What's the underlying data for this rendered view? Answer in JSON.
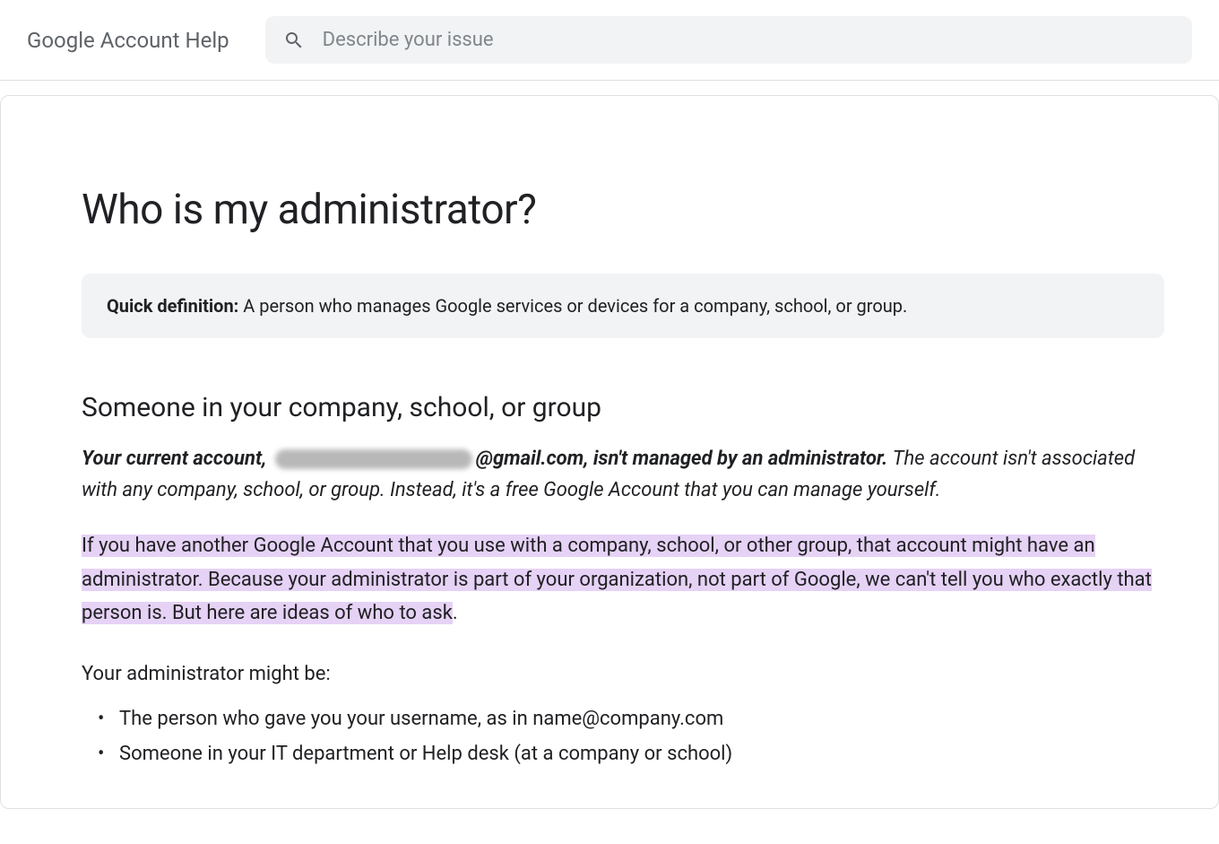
{
  "header": {
    "site_title": "Google Account Help",
    "search_placeholder": "Describe your issue"
  },
  "main": {
    "title": "Who is my administrator?",
    "definition": {
      "label": "Quick definition:",
      "text": " A person who manages Google services or devices for a company, school, or group."
    },
    "section_heading": "Someone in your company, school, or group",
    "account_status": {
      "prefix": "Your current account, ",
      "suffix_bold": "@gmail.com, isn't managed by an administrator.",
      "explanation": " The account isn't associated with any company, school, or group. Instead, it's a free Google Account that you can manage yourself."
    },
    "highlighted_text": "If you have another Google Account that you use with a company, school, or other group, that account might have an administrator. Because your administrator is part of your organization, not part of Google, we can't tell you who exactly that person is. But here are ideas of who to ask",
    "highlighted_period": ".",
    "sub_heading": "Your administrator might be:",
    "list_items": [
      "The person who gave you your username, as in name@company.com",
      "Someone in your IT department or Help desk (at a company or school)"
    ]
  }
}
